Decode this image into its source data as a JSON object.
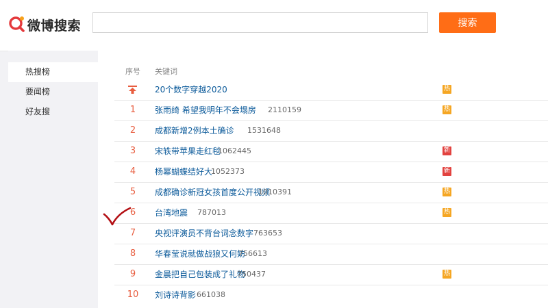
{
  "header": {
    "brand": "微博搜索",
    "search_value": "",
    "search_button": "搜索",
    "colors": {
      "accent": "#ff6d16",
      "logo_red": "#e4393c",
      "logo_orange": "#f7a11b"
    }
  },
  "sidebar": {
    "items": [
      {
        "label": "热搜榜",
        "active": true
      },
      {
        "label": "要闻榜",
        "active": false
      },
      {
        "label": "好友搜",
        "active": false
      }
    ]
  },
  "table": {
    "col_rank": "序号",
    "col_keyword": "关键词",
    "rows": [
      {
        "rank": "",
        "icon": "pinned-top-icon",
        "title": "20个数字穿越2020",
        "count": "",
        "badge": "热"
      },
      {
        "rank": "1",
        "title": "张雨绮 希望我明年不会塌房",
        "count": "2110159",
        "badge": "热"
      },
      {
        "rank": "2",
        "title": "成都新增2例本土确诊",
        "count": "1531648",
        "badge": ""
      },
      {
        "rank": "3",
        "title": "宋轶带苹果走红毯",
        "count": "1062445",
        "badge": "新"
      },
      {
        "rank": "4",
        "title": "杨幂蝴蝶结好大",
        "count": "1052373",
        "badge": "新"
      },
      {
        "rank": "5",
        "title": "成都确诊新冠女孩首度公开视频",
        "count": "1010391",
        "badge": "热"
      },
      {
        "rank": "6",
        "title": "台湾地震",
        "count": "787013",
        "badge": "热"
      },
      {
        "rank": "7",
        "title": "央视评演员不背台词念数字",
        "count": "763653",
        "badge": ""
      },
      {
        "rank": "8",
        "title": "华春莹说就做战狼又何妨",
        "count": "756613",
        "badge": ""
      },
      {
        "rank": "9",
        "title": "金晨把自己包装成了礼物",
        "count": "750437",
        "badge": "热"
      },
      {
        "rank": "10",
        "title": "刘诗诗背影",
        "count": "661038",
        "badge": ""
      }
    ],
    "badge_colors": {
      "热": "#f5a623",
      "新": "#e2423f"
    }
  },
  "annotation": {
    "icon": "red-checkmark-icon",
    "color": "#b30f14"
  }
}
